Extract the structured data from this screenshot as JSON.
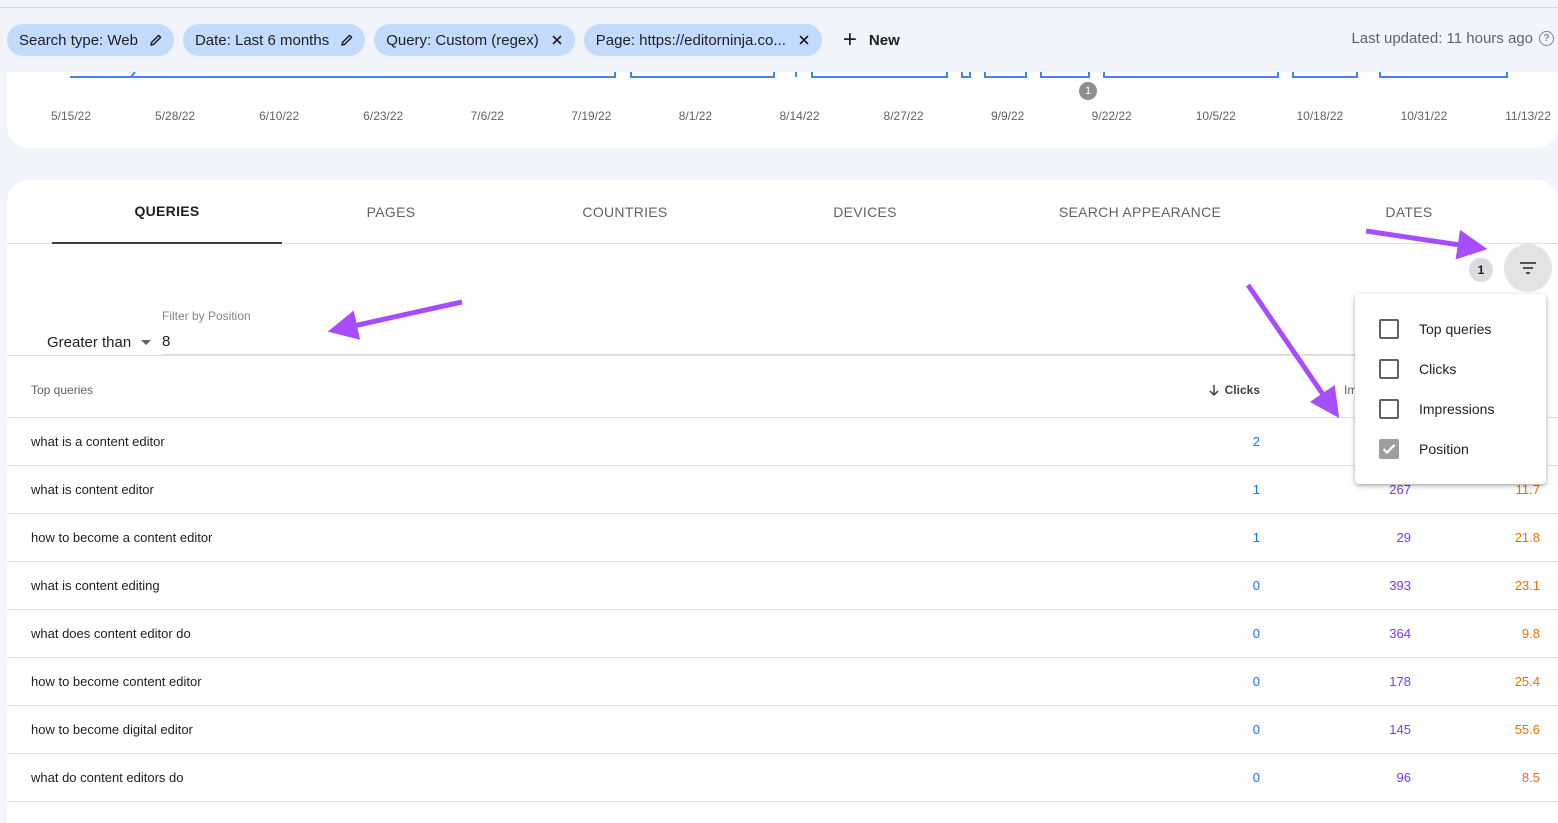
{
  "filters": {
    "chips": [
      {
        "label": "Search type: Web",
        "icon": "pencil-icon"
      },
      {
        "label": "Date: Last 6 months",
        "icon": "pencil-icon"
      },
      {
        "label": "Query: Custom (regex)",
        "icon": "close-icon"
      },
      {
        "label": "Page: https://editorninja.co...",
        "icon": "close-icon"
      }
    ],
    "new_label": "New",
    "last_updated": "Last updated: 11 hours ago"
  },
  "chart": {
    "x_ticks": [
      "5/15/22",
      "5/28/22",
      "6/10/22",
      "6/23/22",
      "7/6/22",
      "7/19/22",
      "8/1/22",
      "8/14/22",
      "8/27/22",
      "9/9/22",
      "9/22/22",
      "10/5/22",
      "10/18/22",
      "10/31/22",
      "11/13/22"
    ],
    "annotation_count": "1",
    "line_color": "#4285f4"
  },
  "tabs": [
    "Queries",
    "Pages",
    "Countries",
    "Devices",
    "Search appearance",
    "Dates"
  ],
  "active_tab": "Queries",
  "filter_count": "1",
  "position_filter": {
    "label": "Filter by Position",
    "operator": "Greater than",
    "value": "8"
  },
  "table": {
    "headers": {
      "query": "Top queries",
      "clicks": "Clicks",
      "impressions": "Im"
    },
    "rows": [
      {
        "query": "what is a content editor",
        "clicks": "2",
        "impressions": "",
        "position": ""
      },
      {
        "query": "what is content editor",
        "clicks": "1",
        "impressions": "267",
        "position": "11.7"
      },
      {
        "query": "how to become a content editor",
        "clicks": "1",
        "impressions": "29",
        "position": "21.8"
      },
      {
        "query": "what is content editing",
        "clicks": "0",
        "impressions": "393",
        "position": "23.1"
      },
      {
        "query": "what does content editor do",
        "clicks": "0",
        "impressions": "364",
        "position": "9.8"
      },
      {
        "query": "how to become content editor",
        "clicks": "0",
        "impressions": "178",
        "position": "25.4"
      },
      {
        "query": "how to become digital editor",
        "clicks": "0",
        "impressions": "145",
        "position": "55.6"
      },
      {
        "query": "what do content editors do",
        "clicks": "0",
        "impressions": "96",
        "position": "8.5"
      }
    ]
  },
  "columns_menu": {
    "items": [
      {
        "label": "Top queries",
        "checked": false
      },
      {
        "label": "Clicks",
        "checked": false
      },
      {
        "label": "Impressions",
        "checked": false
      },
      {
        "label": "Position",
        "checked": true
      }
    ]
  },
  "colors": {
    "chip_bg": "#c2dbff",
    "clicks": "#1a73e8",
    "impressions": "#7c3aed",
    "position": "#e8710a",
    "annotation_arrow": "#a64dff"
  }
}
